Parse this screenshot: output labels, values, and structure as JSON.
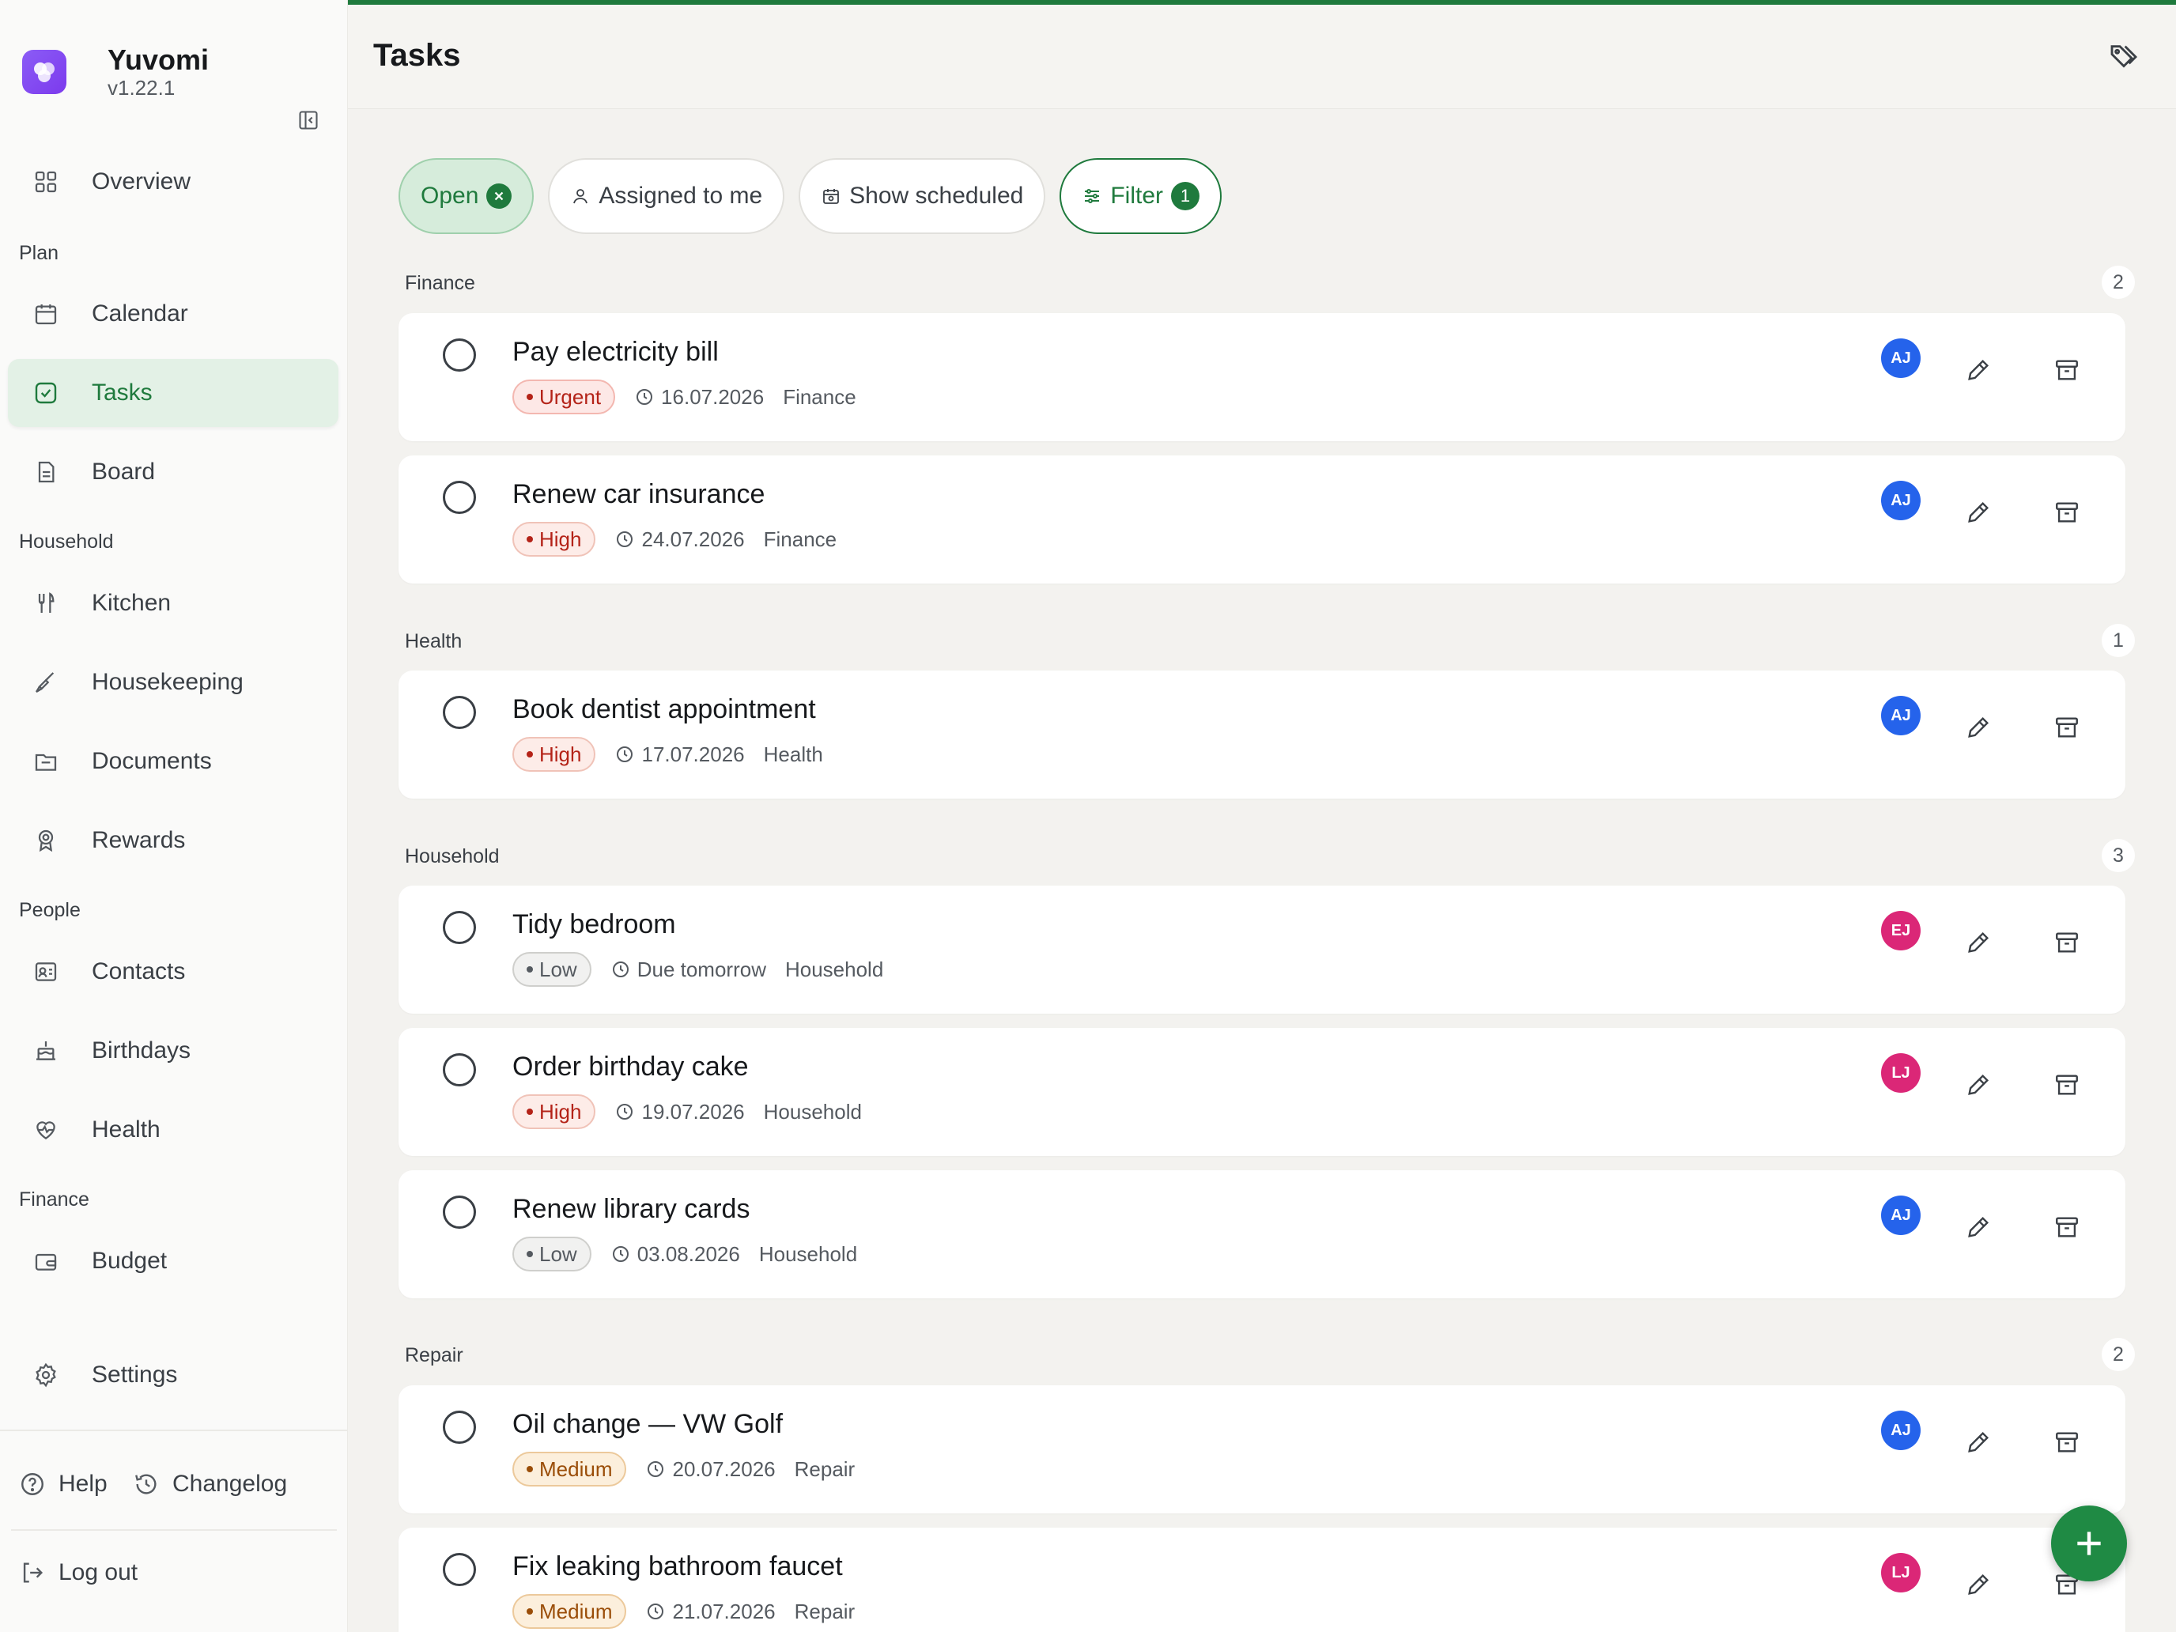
{
  "brand": {
    "name": "Yuvomi",
    "version": "v1.22.1"
  },
  "nav": {
    "overview": "Overview",
    "section_plan": "Plan",
    "calendar": "Calendar",
    "tasks": "Tasks",
    "board": "Board",
    "section_household": "Household",
    "kitchen": "Kitchen",
    "housekeeping": "Housekeeping",
    "documents": "Documents",
    "rewards": "Rewards",
    "section_people": "People",
    "contacts": "Contacts",
    "birthdays": "Birthdays",
    "health": "Health",
    "section_finance": "Finance",
    "budget": "Budget",
    "settings": "Settings",
    "help": "Help",
    "changelog": "Changelog",
    "logout": "Log out"
  },
  "header": {
    "title": "Tasks"
  },
  "filters": {
    "open": "Open",
    "assigned": "Assigned to me",
    "scheduled": "Show scheduled",
    "filter": "Filter",
    "filter_count": "1"
  },
  "groups": [
    {
      "label": "Finance",
      "count": "2"
    },
    {
      "label": "Health",
      "count": "1"
    },
    {
      "label": "Household",
      "count": "3"
    },
    {
      "label": "Repair",
      "count": "2"
    }
  ],
  "tasks": [
    {
      "title": "Pay electricity bill",
      "priority": "Urgent",
      "due": "16.07.2026",
      "category": "Finance",
      "assignee": "AJ"
    },
    {
      "title": "Renew car insurance",
      "priority": "High",
      "due": "24.07.2026",
      "category": "Finance",
      "assignee": "AJ"
    },
    {
      "title": "Book dentist appointment",
      "priority": "High",
      "due": "17.07.2026",
      "category": "Health",
      "assignee": "AJ"
    },
    {
      "title": "Tidy bedroom",
      "priority": "Low",
      "due": "Due tomorrow",
      "category": "Household",
      "assignee": "EJ"
    },
    {
      "title": "Order birthday cake",
      "priority": "High",
      "due": "19.07.2026",
      "category": "Household",
      "assignee": "LJ"
    },
    {
      "title": "Renew library cards",
      "priority": "Low",
      "due": "03.08.2026",
      "category": "Household",
      "assignee": "AJ"
    },
    {
      "title": "Oil change — VW Golf",
      "priority": "Medium",
      "due": "20.07.2026",
      "category": "Repair",
      "assignee": "AJ"
    },
    {
      "title": "Fix leaking bathroom faucet",
      "priority": "Medium",
      "due": "21.07.2026",
      "category": "Repair",
      "assignee": "LJ"
    }
  ],
  "colors": {
    "accent": "#1f7a3d",
    "avatar_aj": "#2563eb",
    "avatar_ej": "#db2777",
    "avatar_lj": "#db2777"
  }
}
